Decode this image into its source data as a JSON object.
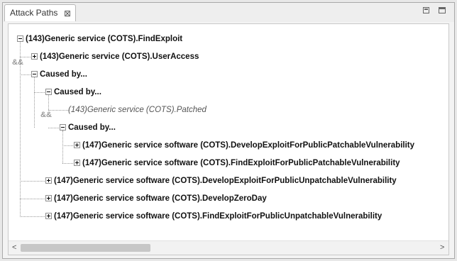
{
  "view": {
    "tab_title": "Attack Paths",
    "tab_close": "⊠"
  },
  "tree": {
    "nodes": [
      {
        "label": "(143)Generic service (COTS).FindExploit",
        "toggle": "minus"
      },
      {
        "label": "(143)Generic service (COTS).UserAccess",
        "toggle": "plus"
      },
      {
        "label": "Caused by...",
        "toggle": "minus"
      },
      {
        "label": "Caused by...",
        "toggle": "minus"
      },
      {
        "label": "(143)Generic service (COTS).Patched",
        "toggle": "none",
        "italic": true
      },
      {
        "label": "Caused by...",
        "toggle": "minus"
      },
      {
        "label": "(147)Generic service software (COTS).DevelopExploitForPublicPatchableVulnerability",
        "toggle": "plus"
      },
      {
        "label": "(147)Generic service software (COTS).FindExploitForPublicPatchableVulnerability",
        "toggle": "plus"
      },
      {
        "label": "(147)Generic service software (COTS).DevelopExploitForPublicUnpatchableVulnerability",
        "toggle": "plus"
      },
      {
        "label": "(147)Generic service software (COTS).DevelopZeroDay",
        "toggle": "plus"
      },
      {
        "label": "(147)Generic service software (COTS).FindExploitForPublicUnpatchableVulnerability",
        "toggle": "plus"
      }
    ],
    "and_markers": [
      "&&",
      "&&"
    ]
  },
  "scrollbar": {
    "left": "<",
    "right": ">"
  }
}
